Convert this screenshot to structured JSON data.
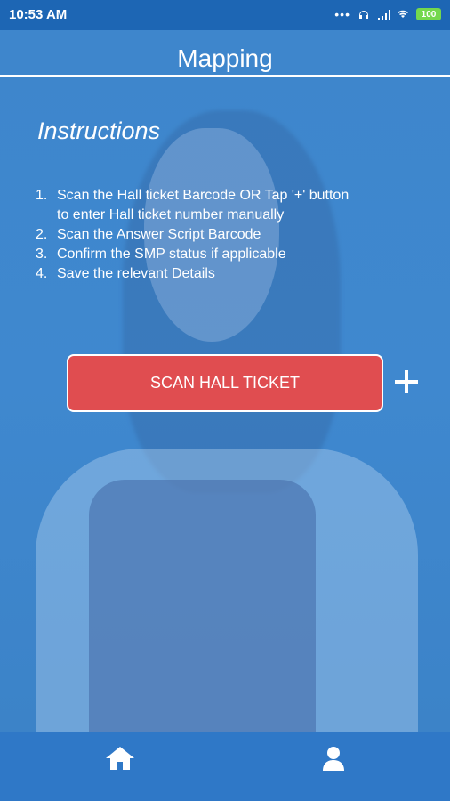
{
  "status_bar": {
    "time": "10:53 AM",
    "battery": "100"
  },
  "header": {
    "title": "Mapping"
  },
  "instructions": {
    "title": "Instructions",
    "lines": [
      {
        "num": "1.",
        "text": "Scan the Hall ticket Barcode OR Tap '+' button"
      },
      {
        "num": "",
        "text": "to enter Hall ticket number manually"
      },
      {
        "num": "2.",
        "text": "Scan the Answer Script Barcode"
      },
      {
        "num": "3.",
        "text": "Confirm the SMP status if applicable"
      },
      {
        "num": "4.",
        "text": "Save the relevant Details"
      }
    ]
  },
  "actions": {
    "scan_label": "SCAN HALL TICKET"
  },
  "colors": {
    "status_bar": "#1d66b4",
    "background": "#3f86cc",
    "button": "#e04d50",
    "bottom_nav": "#2f78c7"
  },
  "icons": {
    "plus": "plus-icon",
    "home": "home-icon",
    "profile": "user-icon"
  }
}
